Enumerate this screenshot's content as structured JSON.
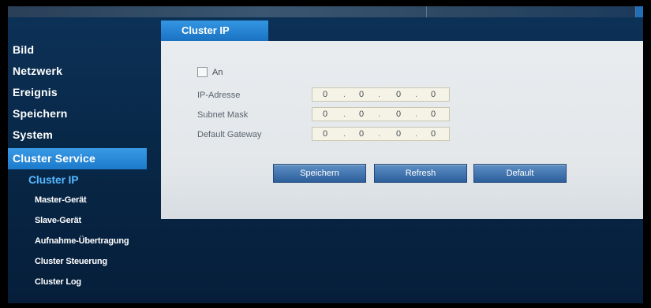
{
  "sidebar": {
    "items": [
      {
        "label": "Bild"
      },
      {
        "label": "Netzwerk"
      },
      {
        "label": "Ereignis"
      },
      {
        "label": "Speichern"
      },
      {
        "label": "System"
      },
      {
        "label": "Cluster Service"
      }
    ],
    "subitems": [
      {
        "label": "Cluster IP"
      },
      {
        "label": "Master-Gerät"
      },
      {
        "label": "Slave-Gerät"
      },
      {
        "label": "Aufnahme-Übertragung"
      },
      {
        "label": "Cluster Steuerung"
      },
      {
        "label": "Cluster Log"
      }
    ]
  },
  "tab": {
    "label": "Cluster IP"
  },
  "form": {
    "enable_label": "An",
    "enable_checked": false,
    "ip_label": "IP-Adresse",
    "ip": [
      "0",
      "0",
      "0",
      "0"
    ],
    "mask_label": "Subnet Mask",
    "mask": [
      "0",
      "0",
      "0",
      "0"
    ],
    "gateway_label": "Default Gateway",
    "gateway": [
      "0",
      "0",
      "0",
      "0"
    ],
    "separator": "."
  },
  "buttons": {
    "save": "Speichern",
    "refresh": "Refresh",
    "default": "Default"
  },
  "colors": {
    "background": "#082848",
    "accent": "#1b7acb",
    "panel": "#e6e9ec",
    "active_subitem": "#55b8ff"
  }
}
